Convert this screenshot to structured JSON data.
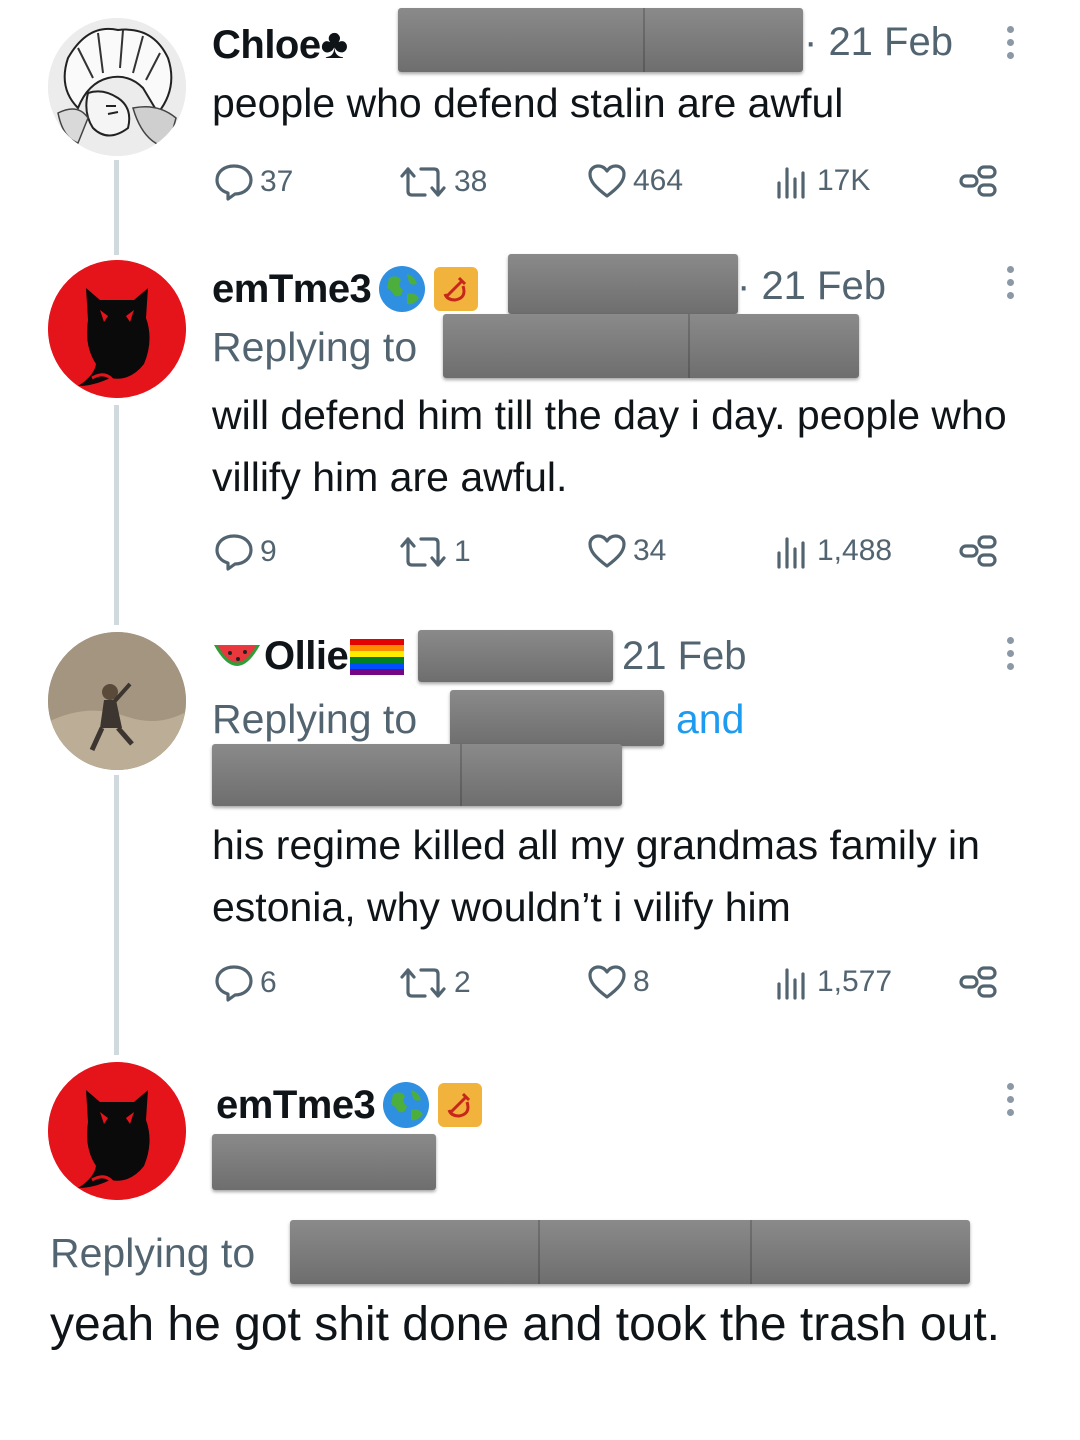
{
  "tweets": [
    {
      "name": "Chloe",
      "name_suffix_icon": "club-suit-icon",
      "date": "21 Feb",
      "text": "people who defend stalin are awful",
      "stats": {
        "replies": "37",
        "retweets": "38",
        "likes": "464",
        "views": "17K"
      }
    },
    {
      "name": "emTme3",
      "name_icons": [
        "globe-icon",
        "hammer-sickle-icon"
      ],
      "date": "21 Feb",
      "replying_to_label": "Replying to",
      "text": "will defend him till the day i day. people who villify him are awful.",
      "stats": {
        "replies": "9",
        "retweets": "1",
        "likes": "34",
        "views": "1,488"
      }
    },
    {
      "name": "Ollie",
      "name_icons": [
        "watermelon-icon",
        "rainbow-flag-icon"
      ],
      "date": "21 Feb",
      "replying_to_label": "Replying to",
      "and_label": "and",
      "text": "his regime killed all my grandmas family in estonia, why wouldn’t i vilify him",
      "stats": {
        "replies": "6",
        "retweets": "2",
        "likes": "8",
        "views": "1,577"
      }
    },
    {
      "name": "emTme3",
      "name_icons": [
        "globe-icon",
        "hammer-sickle-icon"
      ],
      "replying_to_label": "Replying to",
      "text": "yeah he got shit done and took the trash out."
    }
  ],
  "colors": {
    "text": "#0f1419",
    "secondary": "#536471",
    "link": "#1d9bf0",
    "thread_line": "#cfd9de",
    "redaction": "#7a7a7a"
  }
}
